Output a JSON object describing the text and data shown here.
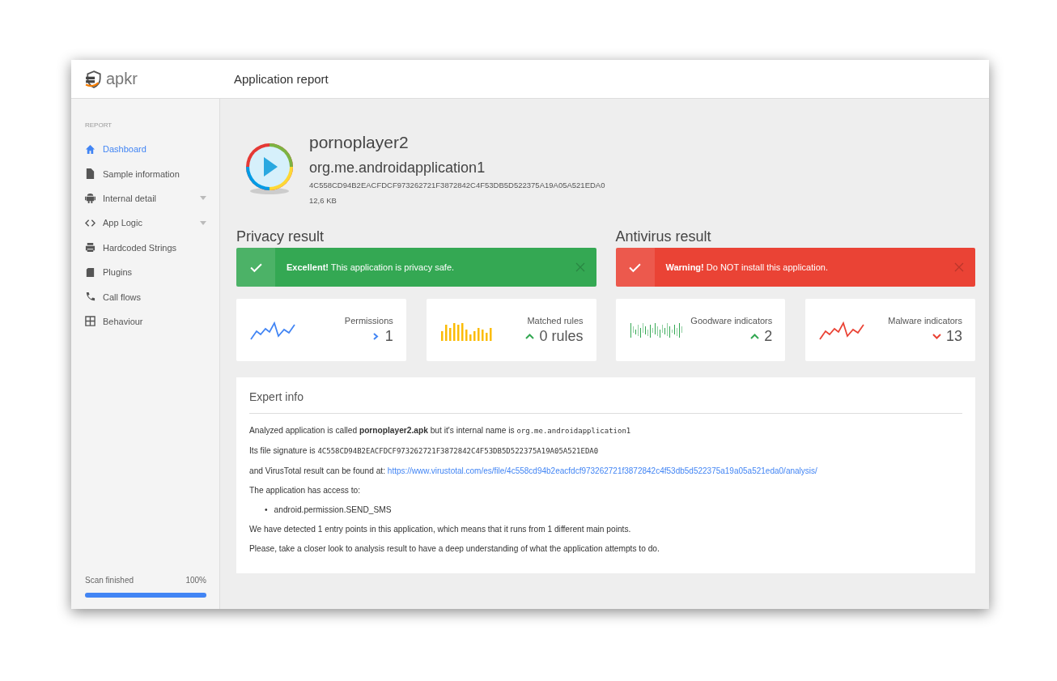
{
  "header": {
    "logo_text": "apkr",
    "title": "Application report"
  },
  "sidebar": {
    "section_label": "REPORT",
    "items": [
      {
        "kind": "home",
        "label": "Dashboard",
        "selected": true,
        "has_submenu": false
      },
      {
        "kind": "file",
        "label": "Sample information",
        "selected": false,
        "has_submenu": false
      },
      {
        "kind": "android",
        "label": "Internal detail",
        "selected": false,
        "has_submenu": true
      },
      {
        "kind": "code",
        "label": "App Logic",
        "selected": false,
        "has_submenu": true
      },
      {
        "kind": "printer",
        "label": "Hardcoded Strings",
        "selected": false,
        "has_submenu": false
      },
      {
        "kind": "card",
        "label": "Plugins",
        "selected": false,
        "has_submenu": false
      },
      {
        "kind": "phone",
        "label": "Call flows",
        "selected": false,
        "has_submenu": false
      },
      {
        "kind": "grid",
        "label": "Behaviour",
        "selected": false,
        "has_submenu": false
      }
    ],
    "progress": {
      "label": "Scan finished",
      "reading": "100%",
      "level": 1
    }
  },
  "app": {
    "name": "pornoplayer2",
    "package": "org.me.androidapplication1",
    "hash": "4C558CD94B2EACFDCF973262721F3872842C4F53DB5D522375A19A05A521EDA0",
    "size": "12,6 KB"
  },
  "results": [
    {
      "title": "Privacy result",
      "alert": {
        "kind": "success",
        "message": "**Excellent!** This application is privacy safe."
      },
      "stats": [
        {
          "label": "Permissions",
          "value": "1",
          "trend": {
            "kind": "right"
          },
          "sparkline": {
            "kind": "line",
            "color": "#4285f4"
          }
        },
        {
          "label": "Matched rules",
          "value": "0 rules",
          "trend": {
            "kind": "up"
          },
          "sparkline": {
            "kind": "bars",
            "color": "#fbbc05"
          }
        }
      ]
    },
    {
      "title": "Antivirus result",
      "alert": {
        "kind": "danger",
        "message": "**Warning!** Do NOT install this application."
      },
      "stats": [
        {
          "label": "Goodware indicators",
          "value": "2",
          "trend": {
            "kind": "up"
          },
          "sparkline": {
            "kind": "ticks",
            "color": "#34a853"
          }
        },
        {
          "label": "Malware indicators",
          "value": "13",
          "trend": {
            "kind": "down"
          },
          "sparkline": {
            "kind": "line",
            "color": "#ea4335"
          }
        }
      ]
    }
  ],
  "expert": {
    "title": "Expert info",
    "blocks": [
      {
        "kind": "para",
        "parts": [
          {
            "kind": "text",
            "text": "Analyzed application is called **pornoplayer2.apk** but it's internal name is "
          },
          {
            "kind": "code",
            "text": "org.me.androidapplication1"
          }
        ]
      },
      {
        "kind": "para",
        "parts": [
          {
            "kind": "text",
            "text": "Its file signature is "
          },
          {
            "kind": "code",
            "text": "4C558CD94B2EACFDCF973262721F3872842C4F53DB5D522375A19A05A521EDA0"
          }
        ]
      },
      {
        "kind": "para",
        "parts": [
          {
            "kind": "text",
            "text": "and VirusTotal result can be found at: "
          },
          {
            "kind": "link",
            "text": "https://www.virustotal.com/es/file/4c558cd94b2eacfdcf973262721f3872842c4f53db5d522375a19a05a521eda0/analysis/"
          }
        ]
      },
      {
        "kind": "para",
        "parts": [
          {
            "kind": "text",
            "text": "The application has access to:"
          }
        ]
      },
      {
        "kind": "list",
        "items": [
          {
            "bullet": "•",
            "text": "android.permission.SEND_SMS"
          }
        ]
      },
      {
        "kind": "para",
        "parts": [
          {
            "kind": "text",
            "text": "We have detected 1 entry points in this application, which means that it runs from 1 different main points."
          }
        ]
      },
      {
        "kind": "para",
        "parts": [
          {
            "kind": "text",
            "text": "Please, take a closer look to analysis result to have a deep understanding of what the application attempts to do."
          }
        ]
      }
    ]
  }
}
